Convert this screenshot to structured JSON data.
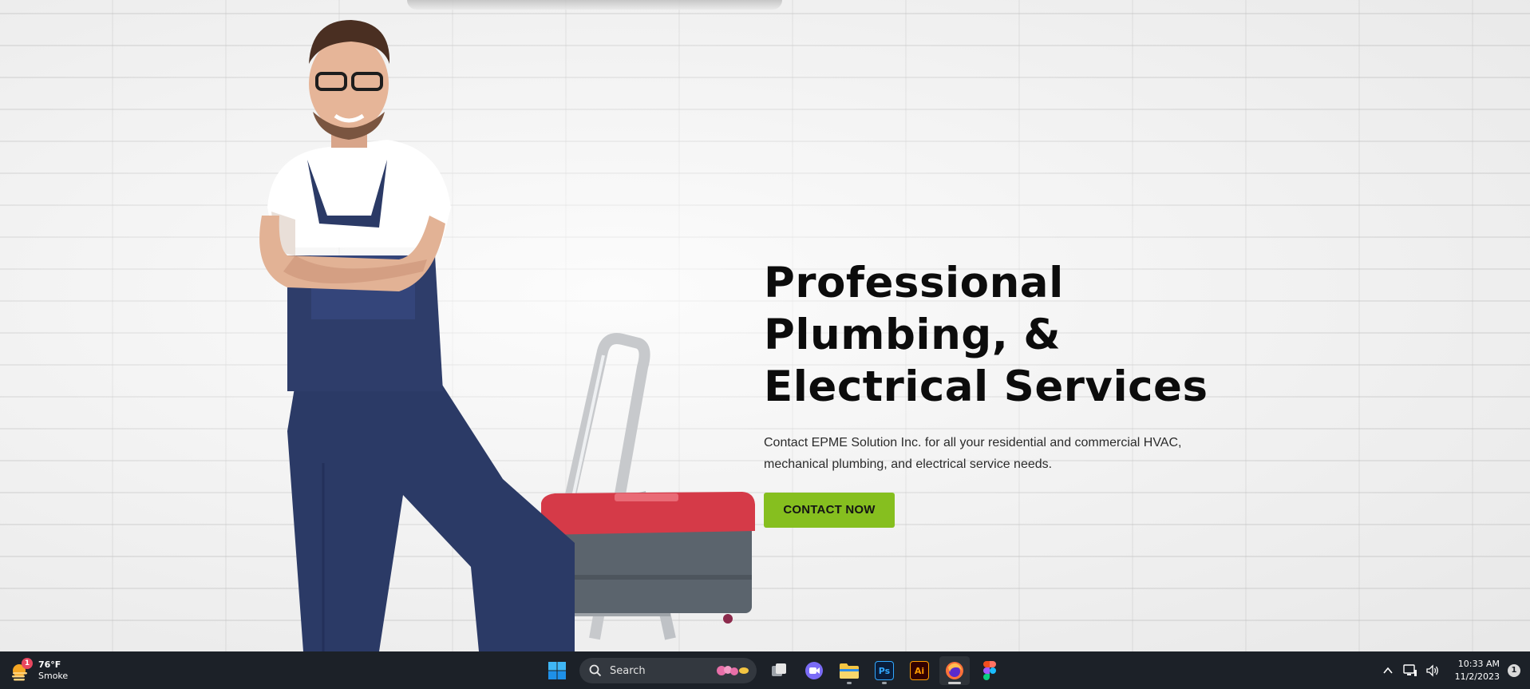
{
  "hero": {
    "title_line1": "Professional",
    "title_line2": "Plumbing, &",
    "title_line3": "Electrical Services",
    "description": "Contact EPME Solution Inc. for all your residential and commercial HVAC, mechanical plumbing, and electrical service needs.",
    "cta_label": "CONTACT NOW",
    "accent_color": "#86bf1f"
  },
  "taskbar": {
    "weather": {
      "badge": "1",
      "temperature": "76°F",
      "condition": "Smoke"
    },
    "search_label": "Search",
    "apps": [
      "windows-start",
      "search",
      "task-view",
      "zoom",
      "file-explorer",
      "photoshop",
      "illustrator",
      "firefox",
      "figma"
    ],
    "photoshop_label": "Ps",
    "illustrator_label": "Ai",
    "clock": {
      "time": "10:33 AM",
      "date": "11/2/2023"
    },
    "notification_count": "1"
  }
}
